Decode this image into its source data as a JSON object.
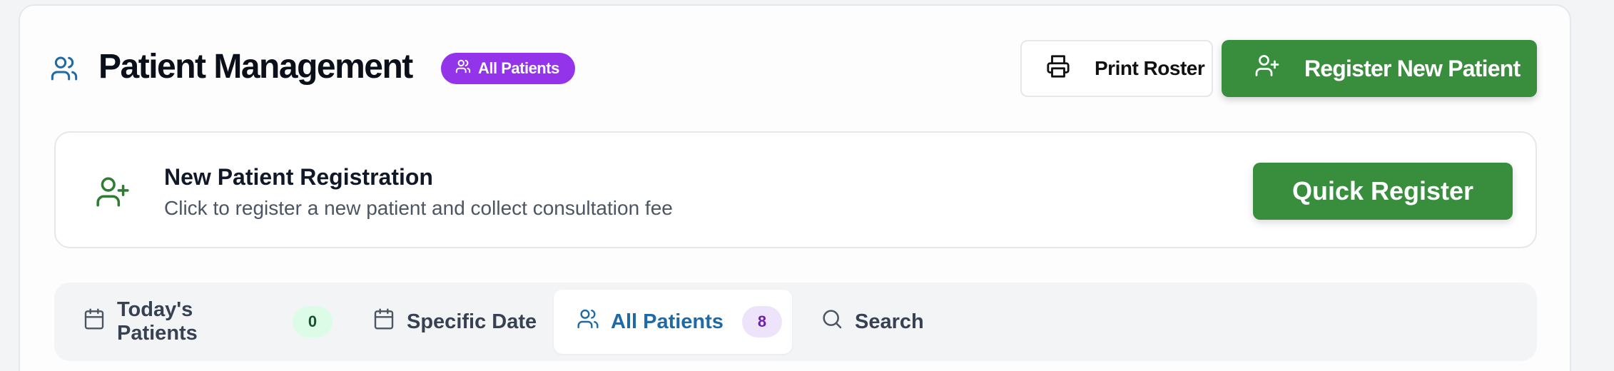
{
  "header": {
    "title": "Patient Management",
    "title_icon": "users-icon",
    "badge_label": "All Patients",
    "badge_icon": "users-icon",
    "print_label": "Print Roster",
    "print_icon": "printer-icon",
    "register_label": "Register New Patient",
    "register_icon": "user-plus-icon"
  },
  "registration": {
    "icon": "user-plus-icon",
    "title": "New Patient Registration",
    "description": "Click to register a new patient and collect consultation fee",
    "quick_label": "Quick Register"
  },
  "tabs": [
    {
      "label": "Today's Patients",
      "icon": "calendar-icon",
      "count": "0",
      "active": false
    },
    {
      "label": "Specific Date",
      "icon": "calendar-icon",
      "active": false
    },
    {
      "label": "All Patients",
      "icon": "users-icon",
      "count": "8",
      "active": true
    },
    {
      "label": "Search",
      "icon": "search-icon",
      "active": false
    }
  ],
  "colors": {
    "primary_green": "#388e3c",
    "badge_purple": "#9333ea",
    "active_tab_blue": "#1f6aa5",
    "title_icon_blue": "#1f6aa5",
    "registration_icon_green": "#2e7d32"
  }
}
